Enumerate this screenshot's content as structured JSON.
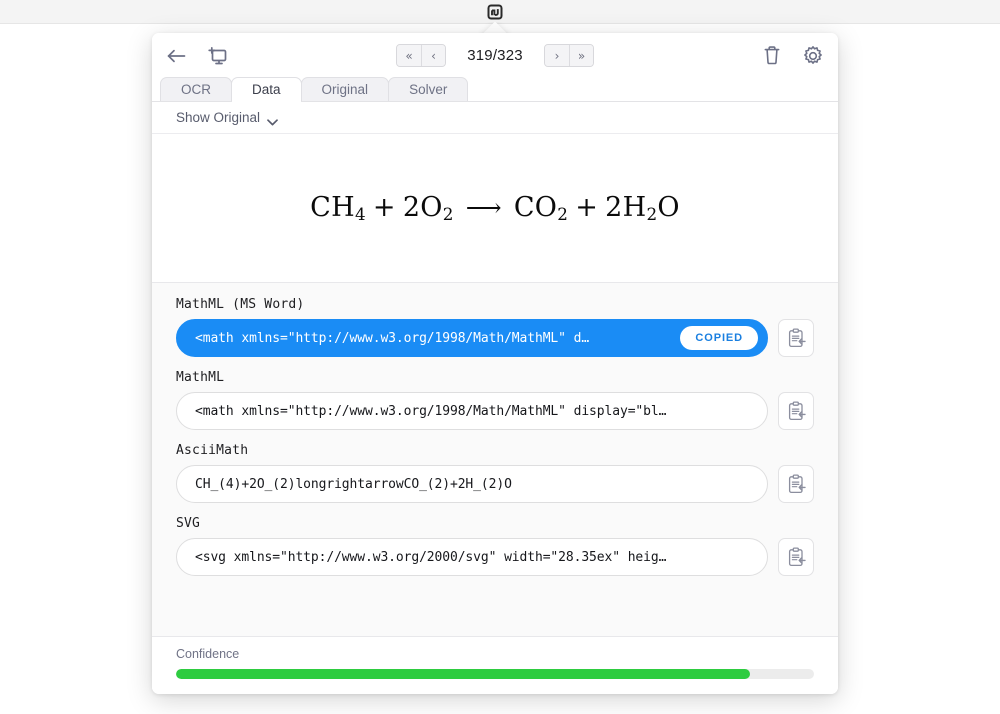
{
  "menubar": {
    "app_icon": "mathpix-snip-icon"
  },
  "toolbar": {
    "back_icon": "back-arrow-icon",
    "new_snip_icon": "new-snip-icon",
    "trash_icon": "trash-icon",
    "settings_icon": "gear-icon",
    "pager": {
      "first_label": "«",
      "prev_label": "‹",
      "next_label": "›",
      "last_label": "»",
      "count": "319/323"
    }
  },
  "tabs": [
    {
      "label": "OCR",
      "active": false
    },
    {
      "label": "Data",
      "active": true
    },
    {
      "label": "Original",
      "active": false
    },
    {
      "label": "Solver",
      "active": false
    }
  ],
  "show_original": {
    "label": "Show Original",
    "chevron_icon": "chevron-down-icon"
  },
  "preview": {
    "equation_plain": "CH4 + 2O2 ⟶ CO2 + 2H2O",
    "parts": {
      "ch": "CH",
      "ch_sub": "4",
      "plus1": "+",
      "o2_coeff": "2O",
      "o2_sub": "2",
      "arrow": "⟶",
      "co": "CO",
      "co_sub": "2",
      "plus2": "+",
      "h2o_coeff": "2H",
      "h2o_sub": "2",
      "h2o_tail": "O"
    }
  },
  "fields": [
    {
      "label": "MathML (MS Word)",
      "value": "<math xmlns=\"http://www.w3.org/1998/Math/MathML\" d…",
      "copied": true,
      "badge": "COPIED",
      "paste_icon": "clipboard-paste-icon"
    },
    {
      "label": "MathML",
      "value": "<math xmlns=\"http://www.w3.org/1998/Math/MathML\" display=\"bl…",
      "copied": false,
      "badge": "",
      "paste_icon": "clipboard-paste-icon"
    },
    {
      "label": "AsciiMath",
      "value": "CH_(4)+2O_(2)longrightarrowCO_(2)+2H_(2)O",
      "copied": false,
      "badge": "",
      "paste_icon": "clipboard-paste-icon"
    },
    {
      "label": "SVG",
      "value": "<svg xmlns=\"http://www.w3.org/2000/svg\" width=\"28.35ex\" heig…",
      "copied": false,
      "badge": "",
      "paste_icon": "clipboard-paste-icon"
    }
  ],
  "confidence": {
    "label": "Confidence",
    "percent": 90
  },
  "colors": {
    "accent_blue": "#1a8cf5",
    "confidence_green": "#2ecc40",
    "badge_text": "#1a7fe0"
  }
}
